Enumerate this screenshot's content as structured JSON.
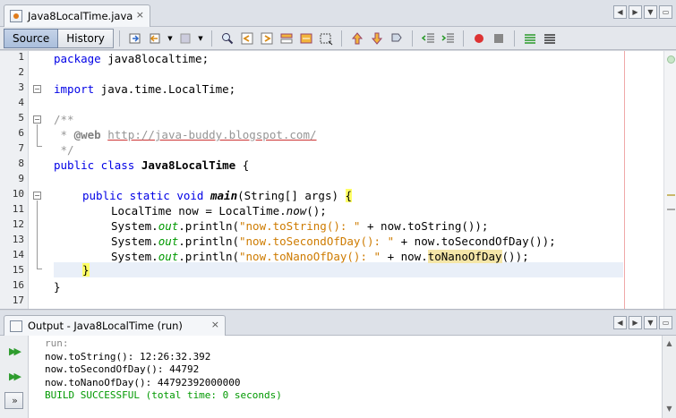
{
  "editor_tab": {
    "title": "Java8LocalTime.java",
    "close": "×"
  },
  "toolbar": {
    "source_label": "Source",
    "history_label": "History"
  },
  "nav": {
    "left": "◀",
    "right": "▶",
    "down": "▼",
    "restore": "▭"
  },
  "editor": {
    "line_numbers": [
      "1",
      "2",
      "3",
      "4",
      "5",
      "6",
      "7",
      "8",
      "9",
      "10",
      "11",
      "12",
      "13",
      "14",
      "15",
      "16",
      "17"
    ],
    "package_kw": "package",
    "package_name": " java8localtime;",
    "import_kw": "import",
    "import_name": " java.time.LocalTime;",
    "javadoc_open": "/**",
    "javadoc_star": " * ",
    "javadoc_tag": "@web",
    "javadoc_url": "http://java-buddy.blogspot.com/",
    "javadoc_close": " */",
    "class_kw": "public class ",
    "class_name": "Java8LocalTime",
    "class_open": " {",
    "method_mods": "public static void ",
    "method_name": "main",
    "method_params": "(String[] args) ",
    "method_brace": "{",
    "l11_type": "LocalTime now = LocalTime.",
    "l11_call": "now",
    "l11_end": "();",
    "sys": "System.",
    "out": "out",
    "println": ".println(",
    "s12": "\"now.toString(): \"",
    "r12": " + now.toString());",
    "s13": "\"now.toSecondOfDay(): \"",
    "r13": " + now.toSecondOfDay());",
    "s14": "\"now.toNanoOfDay(): \"",
    "r14a": " + now.",
    "r14b": "toNanoOfDay",
    "r14c": "());",
    "l15_brace": "}",
    "l16_brace": "}"
  },
  "output": {
    "tab_title": "Output - Java8LocalTime (run)",
    "close": "×",
    "lines": [
      "run:",
      "now.toString(): 12:26:32.392",
      "now.toSecondOfDay(): 44792",
      "now.toNanoOfDay(): 44792392000000",
      "BUILD SUCCESSFUL (total time: 0 seconds)"
    ],
    "rerun_glyph": "▶▶",
    "rerun_alt_glyph": "▶▶",
    "stop_glyph": "»"
  },
  "colors": {
    "keyword": "#0000e6",
    "string": "#ce7b00",
    "field": "#009900",
    "comment": "#969696",
    "build_ok": "#009900"
  }
}
